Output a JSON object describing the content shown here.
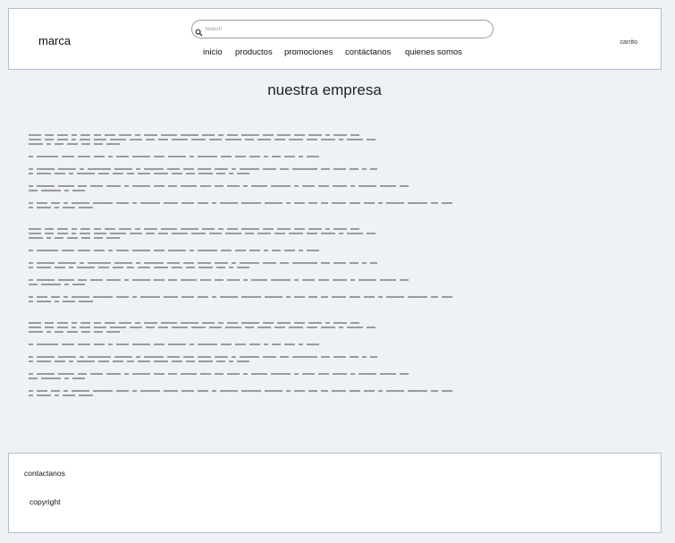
{
  "header": {
    "brand": "marca",
    "search": {
      "placeholder": "Search",
      "value": ""
    },
    "nav": [
      {
        "label": "inicio"
      },
      {
        "label": "productos"
      },
      {
        "label": "promociones"
      },
      {
        "label": "contáctanos"
      },
      {
        "label": "quienes somos"
      }
    ],
    "cart_label": "carrito"
  },
  "main": {
    "title": "nuestra empresa"
  },
  "footer": {
    "contact_label": "contactanos",
    "copyright_label": "copyright"
  },
  "icons": {
    "search": "search-icon"
  }
}
